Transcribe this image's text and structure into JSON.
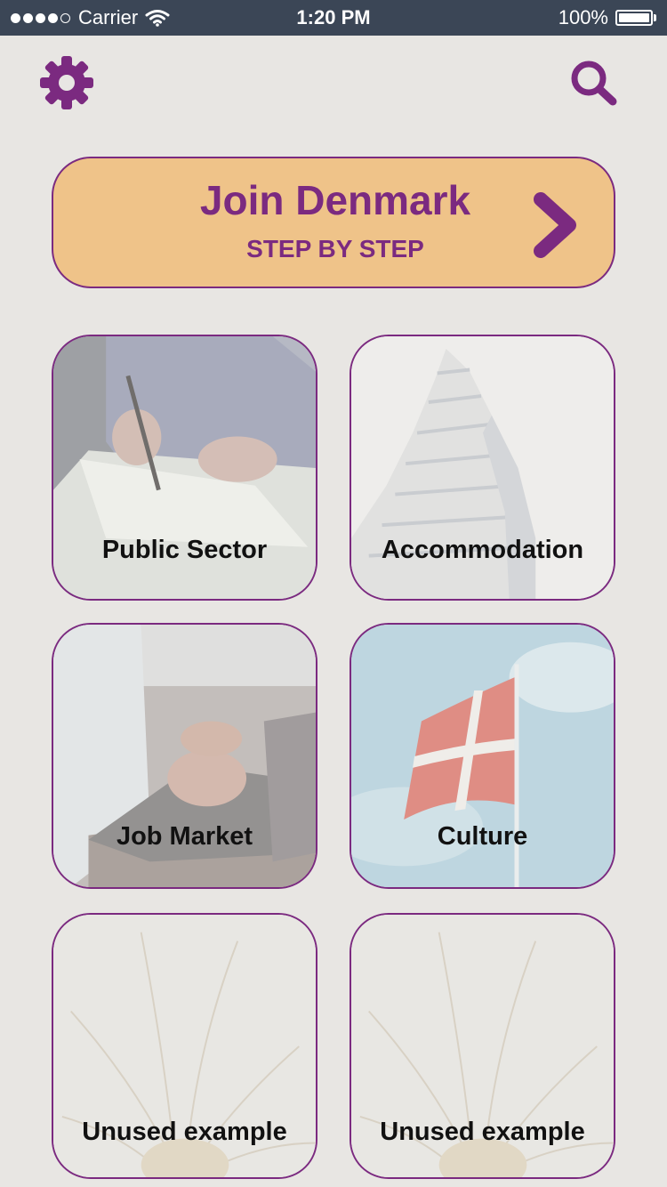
{
  "status_bar": {
    "carrier": "Carrier",
    "time": "1:20 PM",
    "battery": "100%",
    "signal_icon": "signal-dots-icon",
    "wifi_icon": "wifi-icon",
    "battery_icon": "battery-full-icon"
  },
  "header": {
    "settings_icon": "gear-icon",
    "search_icon": "search-icon"
  },
  "banner": {
    "title": "Join Denmark",
    "subtitle": "STEP BY STEP",
    "chevron_icon": "chevron-right-icon"
  },
  "tiles": [
    {
      "label": "Public Sector"
    },
    {
      "label": "Accommodation"
    },
    {
      "label": "Job Market"
    },
    {
      "label": "Culture"
    },
    {
      "label": "Unused example"
    },
    {
      "label": "Unused example"
    }
  ],
  "colors": {
    "accent": "#7b2a80",
    "banner_bg": "#efc389",
    "page_bg": "#e8e6e3",
    "status_bar_bg": "#3b4656"
  }
}
